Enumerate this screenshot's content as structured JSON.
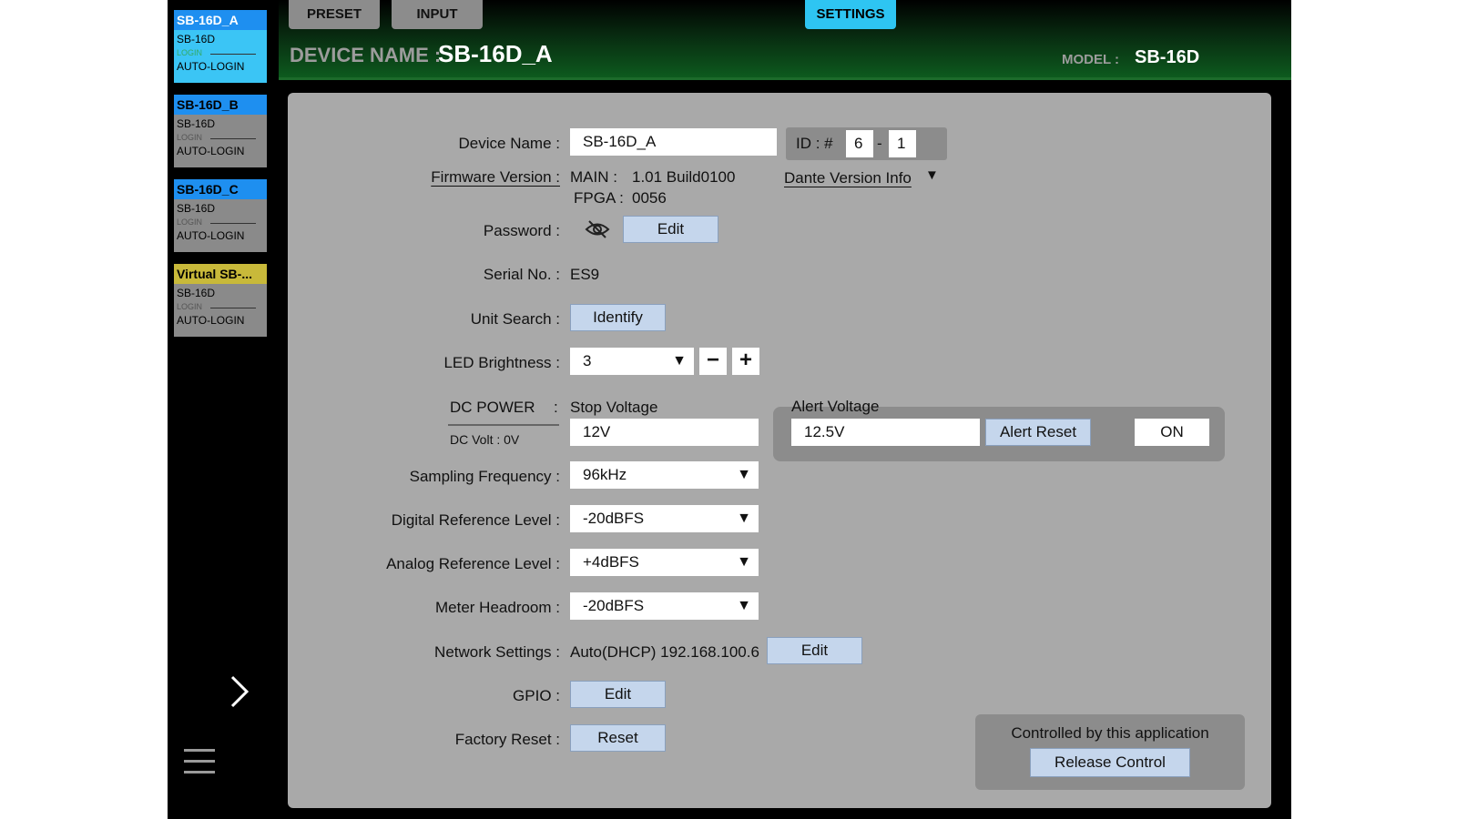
{
  "sidebar": {
    "devices": [
      {
        "name": "SB-16D_A",
        "model": "SB-16D",
        "login": "LOGIN",
        "auto": "AUTO-LOGIN"
      },
      {
        "name": "SB-16D_B",
        "model": "SB-16D",
        "login": "LOGIN",
        "auto": "AUTO-LOGIN"
      },
      {
        "name": "SB-16D_C",
        "model": "SB-16D",
        "login": "LOGIN",
        "auto": "AUTO-LOGIN"
      },
      {
        "name": "Virtual SB-...",
        "model": "SB-16D",
        "login": "LOGIN",
        "auto": "AUTO-LOGIN"
      }
    ]
  },
  "tabs": {
    "preset": "PRESET",
    "input": "INPUT",
    "settings": "SETTINGS"
  },
  "header": {
    "device_name_label": "DEVICE NAME :",
    "device_name_value": "SB-16D_A",
    "model_label": "MODEL :",
    "model_value": "SB-16D"
  },
  "settings": {
    "device_name": {
      "label": "Device Name :",
      "value": "SB-16D_A"
    },
    "id": {
      "label": "ID : #",
      "a": "6",
      "sep": "-",
      "b": "1"
    },
    "firmware": {
      "label": "Firmware Version :",
      "main_label": "MAIN :",
      "main_value": "1.01 Build0100",
      "fpga_label": "FPGA :",
      "fpga_value": "0056"
    },
    "dante": {
      "label": "Dante Version Info",
      "arrow": "▼"
    },
    "password": {
      "label": "Password :",
      "edit": "Edit"
    },
    "serial": {
      "label": "Serial No. :",
      "value": "ES9"
    },
    "unit_search": {
      "label": "Unit Search :",
      "button": "Identify"
    },
    "led": {
      "label": "LED Brightness :",
      "value": "3",
      "minus": "−",
      "plus": "+"
    },
    "dc_power": {
      "label": "DC POWER",
      "colon": ":",
      "dc_volt": "DC Volt : 0V",
      "stop_label": "Stop Voltage",
      "stop_value": "12V",
      "alert_label": "Alert Voltage",
      "alert_value": "12.5V",
      "alert_reset": "Alert Reset",
      "on": "ON"
    },
    "sampling": {
      "label": "Sampling Frequency :",
      "value": "96kHz"
    },
    "digital_ref": {
      "label": "Digital Reference Level :",
      "value": "-20dBFS"
    },
    "analog_ref": {
      "label": "Analog Reference Level :",
      "value": "+4dBFS"
    },
    "meter": {
      "label": "Meter Headroom :",
      "value": "-20dBFS"
    },
    "network": {
      "label": "Network Settings :",
      "value": "Auto(DHCP) 192.168.100.6",
      "edit": "Edit"
    },
    "gpio": {
      "label": "GPIO :",
      "edit": "Edit"
    },
    "factory": {
      "label": "Factory Reset :",
      "button": "Reset"
    },
    "control": {
      "status": "Controlled by this application",
      "button": "Release Control"
    }
  },
  "select_arrow": "▼"
}
